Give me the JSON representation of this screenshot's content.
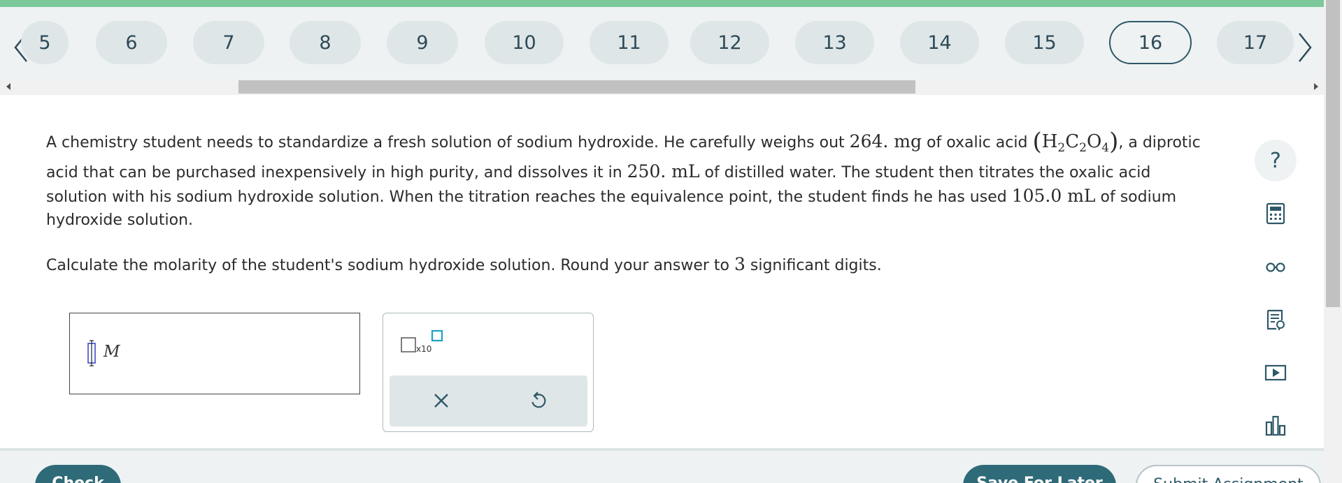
{
  "question_nav": {
    "numbers": [
      "5",
      "6",
      "7",
      "8",
      "9",
      "10",
      "11",
      "12",
      "13",
      "14",
      "15",
      "16",
      "17"
    ],
    "current": "16",
    "prev_icon": "chevron-left-icon",
    "next_icon": "chevron-right-icon"
  },
  "problem": {
    "p1_a": "A chemistry student needs to standardize a fresh solution of sodium hydroxide. He carefully weighs out ",
    "mass": "264. mg",
    "p1_b": " of oxalic acid ",
    "formula": {
      "open": "(",
      "h": "H",
      "h_sub": "2",
      "c": "C",
      "c_sub": "2",
      "o": "O",
      "o_sub": "4",
      "close": ")"
    },
    "p1_c": ", a diprotic acid that can be purchased inexpensively in high purity, and dissolves it in ",
    "volume_water": "250. mL",
    "p1_d": " of distilled water. The student then titrates the oxalic acid solution with his sodium hydroxide solution. When the titration reaches the equivalence point, the student finds he has used ",
    "volume_naoh": "105.0 mL",
    "p1_e": " of sodium hydroxide solution.",
    "p2_a": "Calculate the molarity of the student's sodium hydroxide solution. Round your answer to ",
    "sig_figs": "3",
    "p2_b": " significant digits."
  },
  "answer": {
    "value": "",
    "unit": "M"
  },
  "tool_panel": {
    "sci_label": "x10",
    "clear_icon": "close-icon",
    "undo_icon": "undo-icon"
  },
  "side_tools": [
    "help-icon",
    "calculator-icon",
    "glasses-icon",
    "notes-icon",
    "video-icon",
    "bar-chart-icon"
  ],
  "side_help_label": "?",
  "footer": {
    "check_label": "Check",
    "save_label": "Save For Later",
    "submit_label": "Submit Assignment"
  },
  "colors": {
    "top_bar": "#7cc89a",
    "accent": "#2e6a78",
    "pill": "#dfe6e8"
  }
}
